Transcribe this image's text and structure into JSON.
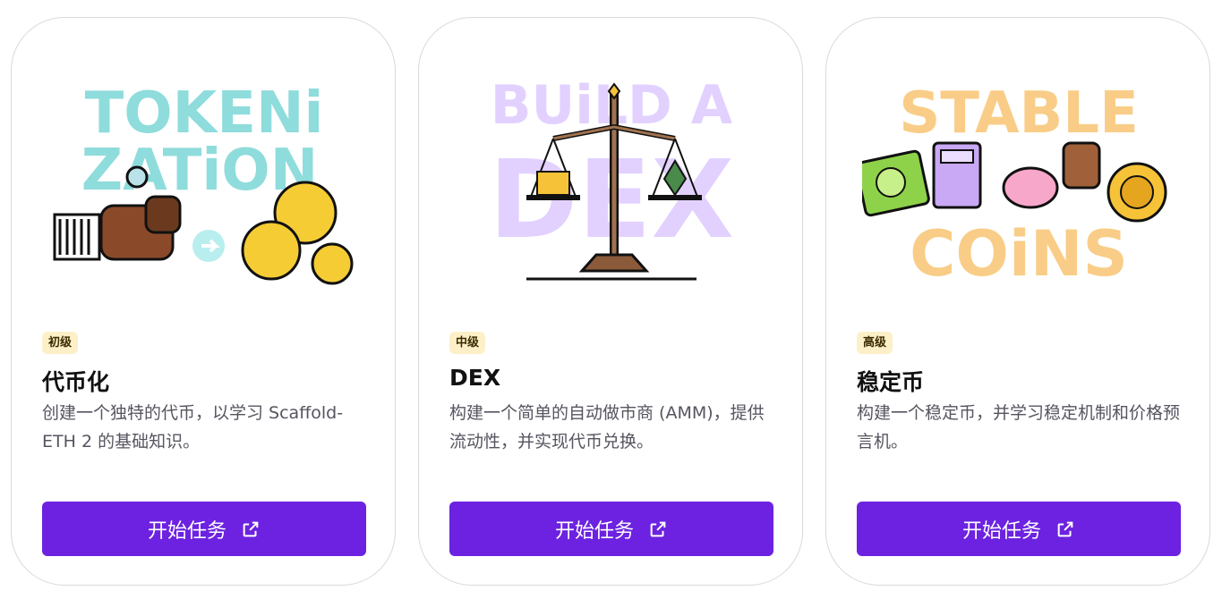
{
  "cards": [
    {
      "art_text": [
        "TOKENi",
        "ZATiON"
      ],
      "level": "初级",
      "title": "代币化",
      "description": "创建一个独特的代币，以学习 Scaffold-ETH 2 的基础知识。",
      "button_label": "开始任务",
      "art_color": "#8fdcdc"
    },
    {
      "art_text": [
        "BUiLD A",
        "DEX"
      ],
      "level": "中级",
      "title": "DEX",
      "description": "构建一个简单的自动做市商 (AMM)，提供流动性，并实现代币兑换。",
      "button_label": "开始任务",
      "art_color": "#e2d1ff"
    },
    {
      "art_text": [
        "STABLE",
        "COiNS"
      ],
      "level": "高级",
      "title": "稳定币",
      "description": "构建一个稳定币，并学习稳定机制和价格预言机。",
      "button_label": "开始任务",
      "art_color": "#f9cd87"
    }
  ],
  "colors": {
    "button": "#6c22e0",
    "badge_bg": "#fdf0c8"
  },
  "icons": {
    "button_icon": "external-link-icon"
  }
}
